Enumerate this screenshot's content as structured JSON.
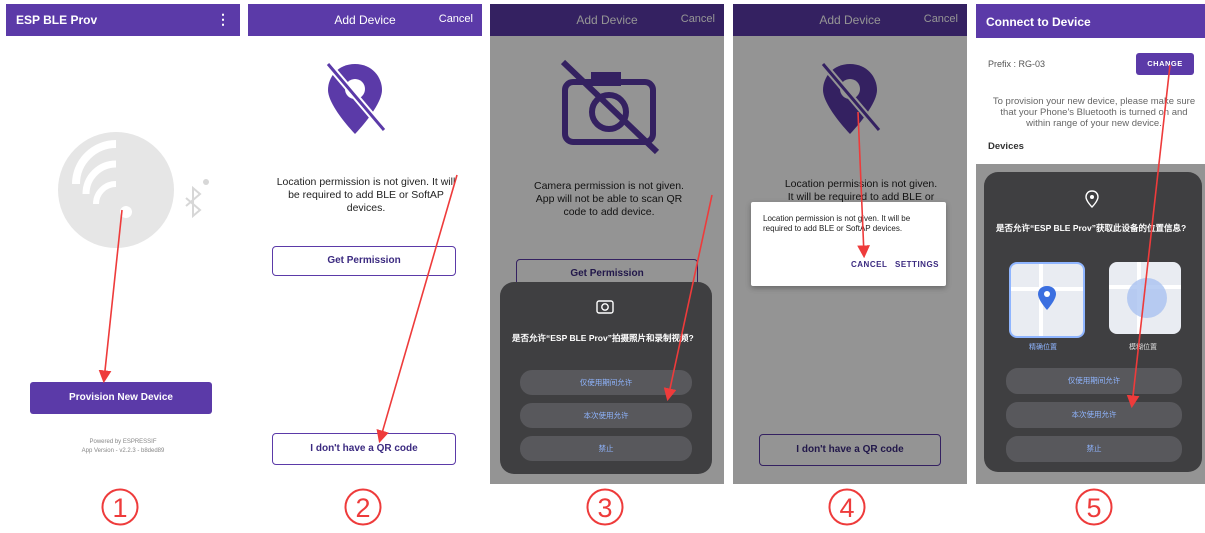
{
  "screens": {
    "s1": {
      "app_title": "ESP BLE Prov",
      "menu_icon": "more-vert-icon",
      "provision_button": "Provision New Device",
      "powered_by": "Powered by ESPRESSIF",
      "app_version": "App Version - v2.2.3 - b8ded89"
    },
    "s2": {
      "title": "Add Device",
      "cancel": "Cancel",
      "message": "Location permission is not given. It will be required to add BLE or SoftAP devices.",
      "get_permission": "Get Permission",
      "no_qr": "I don't have a QR code"
    },
    "s3": {
      "title": "Add Device",
      "cancel": "Cancel",
      "message": "Camera permission is not given. App will not be able to scan QR code to add device.",
      "get_permission": "Get Permission",
      "sheet_title": "是否允许“ESP BLE Prov”拍摄照片和录制视频?",
      "opt_while_using": "仅使用期间允许",
      "opt_this_time": "本次使用允许",
      "opt_deny": "禁止"
    },
    "s4": {
      "title": "Add Device",
      "cancel": "Cancel",
      "message": "Location permission is not given. It will be required to add BLE or SoftAP devices.",
      "dialog_text": "Location permission is not given. It will be required to add BLE or SoftAP devices.",
      "dialog_cancel": "CANCEL",
      "dialog_settings": "SETTINGS",
      "no_qr": "I don't have a QR code"
    },
    "s5": {
      "title": "Connect to Device",
      "prefix": "Prefix : RG-03",
      "change": "CHANGE",
      "info": "To provision your new device, please make sure that your Phone's Bluetooth is turned on and within range of your new device.",
      "devices": "Devices",
      "sheet_title": "是否允许“ESP BLE Prov”获取此设备的位置信息?",
      "precise": "精确位置",
      "approx": "模糊位置",
      "opt_while_using": "仅使用期间允许",
      "opt_this_time": "本次使用允许",
      "opt_deny": "禁止"
    }
  },
  "step_numbers": [
    "1",
    "2",
    "3",
    "4",
    "5"
  ],
  "colors": {
    "accent": "#5b3aa8",
    "arrow": "#ee3b3b",
    "sheet": "#3f3f41"
  }
}
